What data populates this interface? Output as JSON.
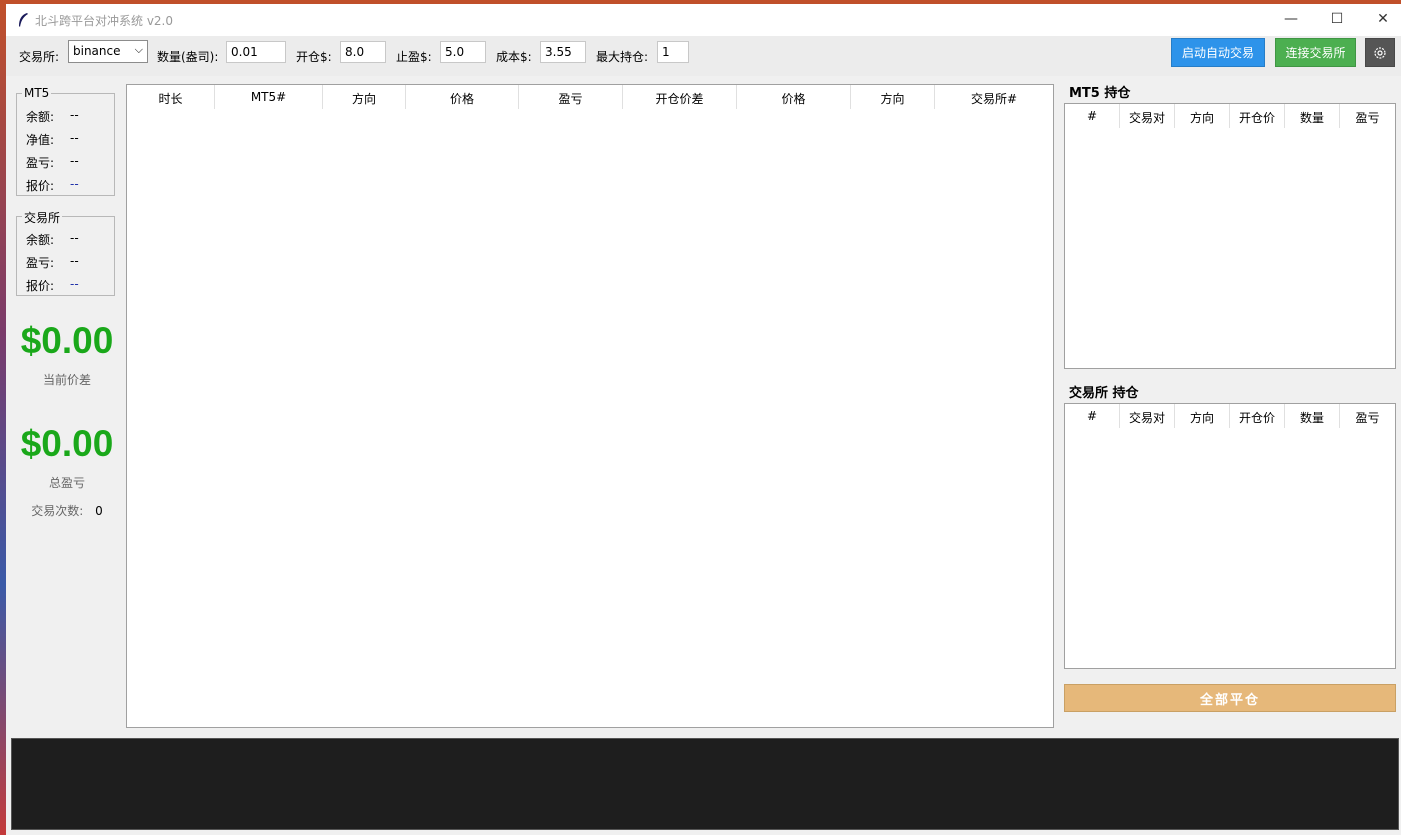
{
  "app": {
    "title": "北斗跨平台对冲系统 v2.0"
  },
  "window_controls": {
    "minimize": "—",
    "maximize": "☐",
    "close": "✕"
  },
  "toolbar": {
    "exchange_label": "交易所:",
    "exchange_value": "binance",
    "qty_label": "数量(盎司):",
    "qty_value": "0.01",
    "open_label": "开仓$:",
    "open_value": "8.0",
    "tp_label": "止盈$:",
    "tp_value": "5.0",
    "cost_label": "成本$:",
    "cost_value": "3.55",
    "max_label": "最大持仓:",
    "max_value": "1",
    "auto_trade_button": "启动自动交易",
    "connect_button": "连接交易所",
    "colors": {
      "auto": "#2d93ea",
      "connect": "#4caf50",
      "gear": "#555555"
    },
    "gear_icon": "gear-icon"
  },
  "mt5_group": {
    "title": "MT5",
    "rows": [
      {
        "label": "余额:",
        "value": "--"
      },
      {
        "label": "净值:",
        "value": "--"
      },
      {
        "label": "盈亏:",
        "value": "--"
      },
      {
        "label": "报价:",
        "value": "--"
      }
    ]
  },
  "exchange_group": {
    "title": "交易所",
    "rows": [
      {
        "label": "余额:",
        "value": "--"
      },
      {
        "label": "盈亏:",
        "value": "--"
      },
      {
        "label": "报价:",
        "value": "--"
      }
    ]
  },
  "summary": {
    "spread_value": "$0.00",
    "spread_caption": "当前价差",
    "total_pnl_value": "$0.00",
    "total_pnl_caption": "总盈亏",
    "trade_count_label": "交易次数:",
    "trade_count_value": "0",
    "value_color": "#1aa81a"
  },
  "main_table": {
    "columns": [
      "时长",
      "MT5#",
      "方向",
      "价格",
      "盈亏",
      "开仓价差",
      "价格",
      "方向",
      "交易所#"
    ]
  },
  "mt5_positions": {
    "title": "MT5 持仓",
    "columns": [
      "#",
      "交易对",
      "方向",
      "开仓价",
      "数量",
      "盈亏"
    ]
  },
  "exchange_positions": {
    "title": "交易所 持仓",
    "columns": [
      "#",
      "交易对",
      "方向",
      "开仓价",
      "数量",
      "盈亏"
    ]
  },
  "close_all_button": "全部平仓",
  "close_all_color": "#e6b87a"
}
